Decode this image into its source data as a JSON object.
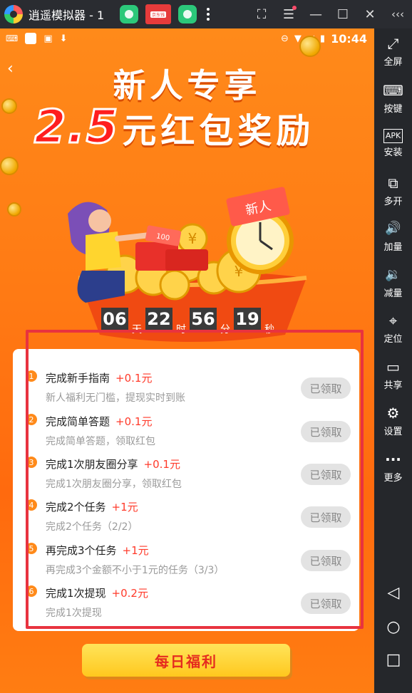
{
  "emulator": {
    "title": "逍遥模拟器 - 1",
    "tab_badge": "京东钱",
    "sidebar": [
      {
        "icon": "fullscreen-icon",
        "glyph": "⤢",
        "label": "全屏"
      },
      {
        "icon": "keyboard-icon",
        "glyph": "⌨",
        "label": "按键"
      },
      {
        "icon": "apk-icon",
        "glyph": "APK",
        "label": "安装"
      },
      {
        "icon": "multi-open-icon",
        "glyph": "⧉",
        "label": "多开"
      },
      {
        "icon": "volume-up-icon",
        "glyph": "🔊",
        "label": "加量"
      },
      {
        "icon": "volume-down-icon",
        "glyph": "🔉",
        "label": "减量"
      },
      {
        "icon": "location-icon",
        "glyph": "⌖",
        "label": "定位"
      },
      {
        "icon": "folder-icon",
        "glyph": "▭",
        "label": "共享"
      },
      {
        "icon": "settings-icon",
        "glyph": "⚙",
        "label": "设置"
      },
      {
        "icon": "more-icon",
        "glyph": "···",
        "label": "更多"
      }
    ]
  },
  "status": {
    "time": "10:44"
  },
  "hero": {
    "line1": "新人专享",
    "amount": "2.5",
    "line2_rest": "元红包奖励",
    "stamp": "新人",
    "note": "100"
  },
  "countdown": {
    "values": [
      "06",
      "22",
      "56",
      "19"
    ],
    "units": [
      "天",
      "时",
      "分",
      "秒"
    ]
  },
  "tasks": [
    {
      "num": "1",
      "title": "完成新手指南",
      "bonus": "+0.1元",
      "desc": "新人福利无门槛，提现实时到账",
      "status": "已领取"
    },
    {
      "num": "2",
      "title": "完成简单答题",
      "bonus": "+0.1元",
      "desc": "完成简单答题，领取红包",
      "status": "已领取"
    },
    {
      "num": "3",
      "title": "完成1次朋友圈分享",
      "bonus": "+0.1元",
      "desc": "完成1次朋友圈分享，领取红包",
      "status": "已领取"
    },
    {
      "num": "4",
      "title": "完成2个任务",
      "bonus": "+1元",
      "desc": "完成2个任务（2/2）",
      "status": "已领取"
    },
    {
      "num": "5",
      "title": "再完成3个任务",
      "bonus": "+1元",
      "desc": "再完成3个金额不小于1元的任务（3/3）",
      "status": "已领取"
    },
    {
      "num": "6",
      "title": "完成1次提现",
      "bonus": "+0.2元",
      "desc": "完成1次提现",
      "status": "已领取"
    }
  ],
  "daily_button": "每日福利",
  "colors": {
    "accent": "#ff7a14",
    "highlight": "#e8333f",
    "bonus": "#ff3a2a"
  }
}
